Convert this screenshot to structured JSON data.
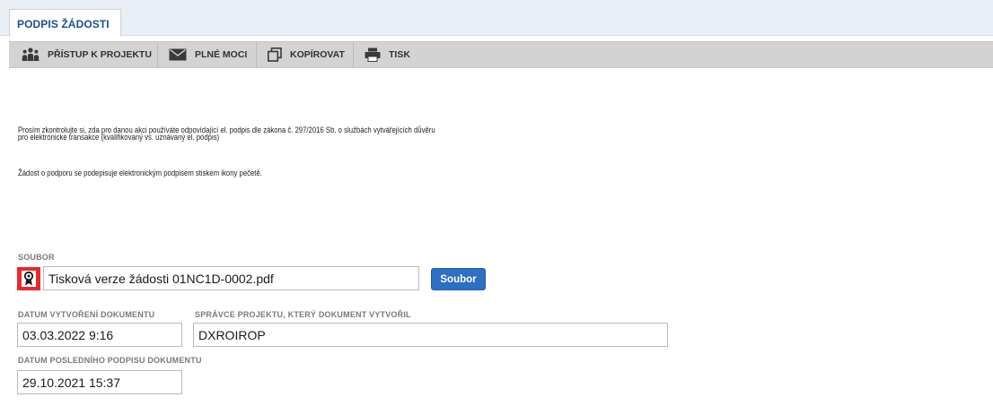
{
  "tab": {
    "label": "PODPIS ŽÁDOSTI"
  },
  "toolbar": {
    "access_label": "PŘÍSTUP K PROJEKTU",
    "access_icon": "people-icon",
    "mail_label": "PLNÉ MOCI",
    "mail_icon": "envelope-icon",
    "copy_label": "KOPÍROVAT",
    "copy_icon": "copy-icon",
    "print_label": "TISK",
    "print_icon": "printer-icon"
  },
  "info": {
    "line1": "Prosím zkontrolujte si, zda pro danou akci používáte odpovídající el. podpis dle zákona č. 297/2016 Sb. o službách vytvářejících důvěru",
    "line2": "pro elektronické transakce (kvalifikovaný vs. uznávaný el. podpis)",
    "line3": "Žádost o podporu se podepisuje elektronickým podpisem stiskem ikony pečetě."
  },
  "file": {
    "label": "SOUBOR",
    "seal_icon": "seal-icon",
    "value": "Tisková verze žádosti 01NC1D-0002.pdf",
    "button_label": "Soubor"
  },
  "created": {
    "label": "DATUM VYTVOŘENÍ DOKUMENTU",
    "value": "03.03.2022 9:16"
  },
  "manager": {
    "label": "SPRÁVCE PROJEKTU, KTERÝ DOKUMENT VYTVOŘIL",
    "value": "DXROIROP"
  },
  "last_signature": {
    "label": "DATUM POSLEDNÍHO PODPISU DOKUMENTU",
    "value": "29.10.2021 15:37"
  },
  "colors": {
    "tab_text": "#1f4f8e",
    "toolbar_bg": "#d3d3d3",
    "seal_red": "#e8292d",
    "button_blue": "#2e6fc2"
  }
}
